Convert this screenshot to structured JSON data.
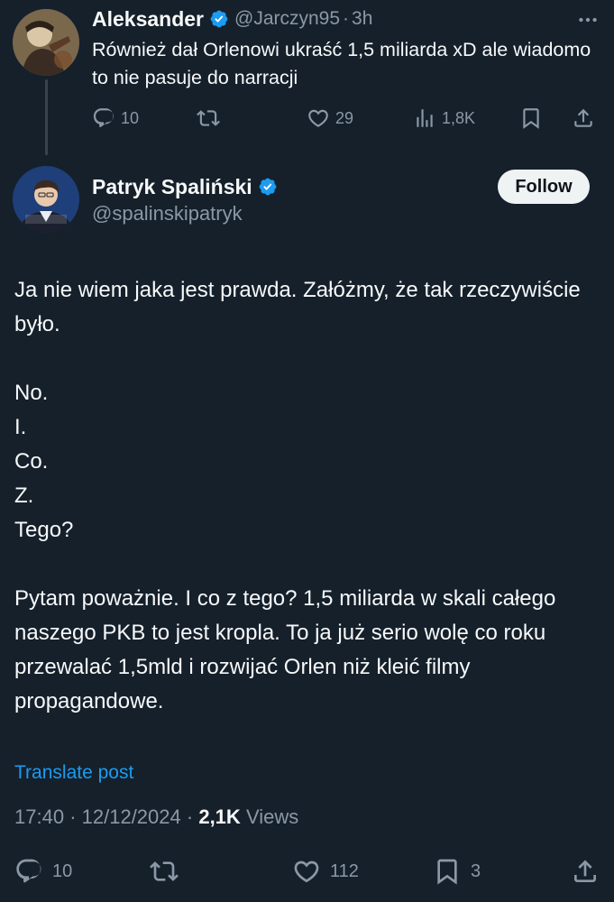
{
  "parent_tweet": {
    "author_name": "Aleksander",
    "handle": "@Jarczyn95",
    "separator": "·",
    "time": "3h",
    "text": "Również dał Orlenowi ukraść 1,5 miliarda xD ale wiadomo to nie pasuje do narracji",
    "replies": "10",
    "retweets": "",
    "likes": "29",
    "views": "1,8K"
  },
  "main_tweet": {
    "author_name": "Patryk Spaliński",
    "handle": "@spalinskipatryk",
    "follow_label": "Follow",
    "paragraphs": {
      "p1": "Ja nie wiem jaka jest prawda. Załóżmy, że tak rzeczywiście było.",
      "l1": "No.",
      "l2": "I.",
      "l3": "Co.",
      "l4": "Z.",
      "l5": "Tego?",
      "p2": "Pytam poważnie. I co z tego? 1,5 miliarda w skali całego naszego PKB to jest kropla. To ja już serio wolę co roku przewalać 1,5mld i rozwijać Orlen niż kleić filmy propagandowe."
    },
    "translate_label": "Translate post",
    "time": "17:40",
    "separator": "·",
    "date": "12/12/2024",
    "views_count": "2,1K",
    "views_label": "Views",
    "replies": "10",
    "retweets": "",
    "likes": "112",
    "bookmarks": "3"
  },
  "colors": {
    "background": "#15202b",
    "text_primary": "#f7f9f9",
    "text_secondary": "#8b98a5",
    "accent_blue": "#1d9bf0",
    "follow_bg": "#eff3f4"
  },
  "icons": [
    "avatar",
    "verified-badge-icon",
    "more-icon",
    "reply-icon",
    "retweet-icon",
    "like-icon",
    "views-icon",
    "bookmark-icon",
    "share-icon"
  ]
}
